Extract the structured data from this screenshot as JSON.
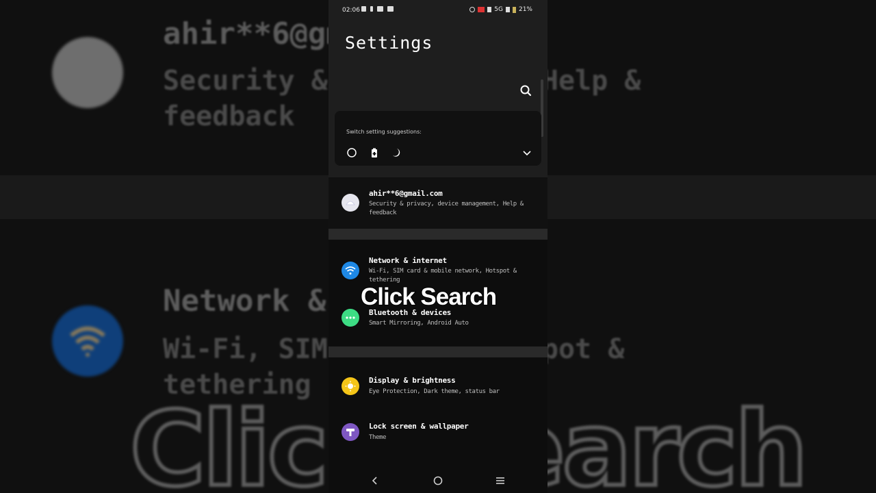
{
  "status_bar": {
    "time": "02:06",
    "network": "5G",
    "battery": "21%"
  },
  "page": {
    "title": "Settings"
  },
  "suggestions": {
    "label": "Switch setting suggestions:",
    "icons": [
      "ring-icon",
      "battery-saver-icon",
      "moon-icon"
    ]
  },
  "account": {
    "email": "ahir**6@gmail.com",
    "subtitle": "Security & privacy, device management, Help & feedback"
  },
  "items": [
    {
      "title": "Network & internet",
      "subtitle": "Wi-Fi, SIM card & mobile network, Hotspot & tethering",
      "icon": "wifi-icon",
      "color": "#1e88e5"
    },
    {
      "title": "Bluetooth & devices",
      "subtitle": "Smart Mirroring, Android Auto",
      "icon": "bluetooth-icon",
      "color": "#3ddc84"
    },
    {
      "title": "Display & brightness",
      "subtitle": "Eye Protection, Dark theme, status bar",
      "icon": "sun-icon",
      "color": "#f5c518"
    },
    {
      "title": "Lock screen & wallpaper",
      "subtitle": "Theme",
      "icon": "wallpaper-icon",
      "color": "#7e57c2"
    }
  ],
  "overlay": {
    "caption": "Click Search"
  },
  "background": {
    "email_fragment": "ahir**6@gm",
    "sub1": "Security & pr                            agement, Help & feedback",
    "net_fragment": "Network & i",
    "sub2": "Wi-Fi, SIM ca                      ork, Hotspot & tethering",
    "click_fragment": "Click Search"
  }
}
